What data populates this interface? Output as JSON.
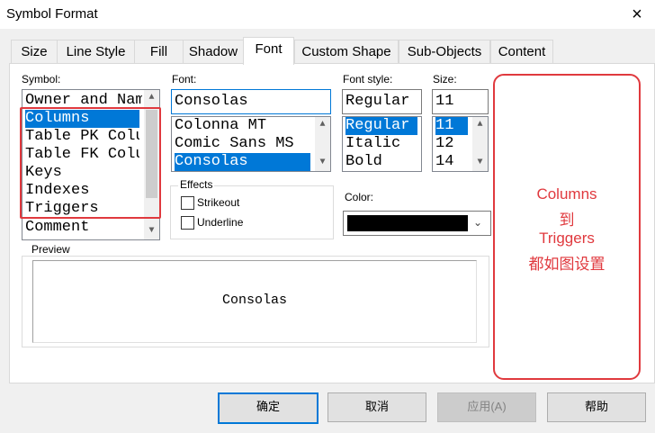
{
  "window": {
    "title": "Symbol Format",
    "close_glyph": "×"
  },
  "tabs": [
    {
      "label": "Size"
    },
    {
      "label": "Line Style"
    },
    {
      "label": "Fill"
    },
    {
      "label": "Shadow"
    },
    {
      "label": "Font"
    },
    {
      "label": "Custom Shape"
    },
    {
      "label": "Sub-Objects"
    },
    {
      "label": "Content"
    }
  ],
  "active_tab": "Font",
  "symbol": {
    "label": "Symbol:",
    "header": "Owner and Name",
    "items": [
      "Columns",
      "Table PK Columns",
      "Table FK Columns",
      "Keys",
      "Indexes",
      "Triggers"
    ],
    "selected": "Columns",
    "footer": "Comment"
  },
  "font": {
    "label": "Font:",
    "value": "Consolas",
    "options": [
      "Colonna MT",
      "Comic Sans MS",
      "Consolas"
    ],
    "selected": "Consolas"
  },
  "font_style": {
    "label": "Font style:",
    "value": "Regular",
    "options": [
      "Regular",
      "Italic",
      "Bold"
    ],
    "selected": "Regular"
  },
  "size": {
    "label": "Size:",
    "value": "11",
    "options": [
      "11",
      "12",
      "14"
    ],
    "selected": "11"
  },
  "effects": {
    "label": "Effects",
    "strikeout": {
      "label": "Strikeout",
      "checked": false
    },
    "underline": {
      "label": "Underline",
      "checked": false
    }
  },
  "color": {
    "label": "Color:",
    "value": "#000000"
  },
  "preview": {
    "label": "Preview",
    "text": "Consolas"
  },
  "annotation": {
    "lines": [
      "Columns",
      "到",
      "Triggers",
      "都如图设置"
    ],
    "color": "#e0393e"
  },
  "buttons": {
    "ok": "确定",
    "cancel": "取消",
    "apply": "应用(A)",
    "help": "帮助"
  }
}
